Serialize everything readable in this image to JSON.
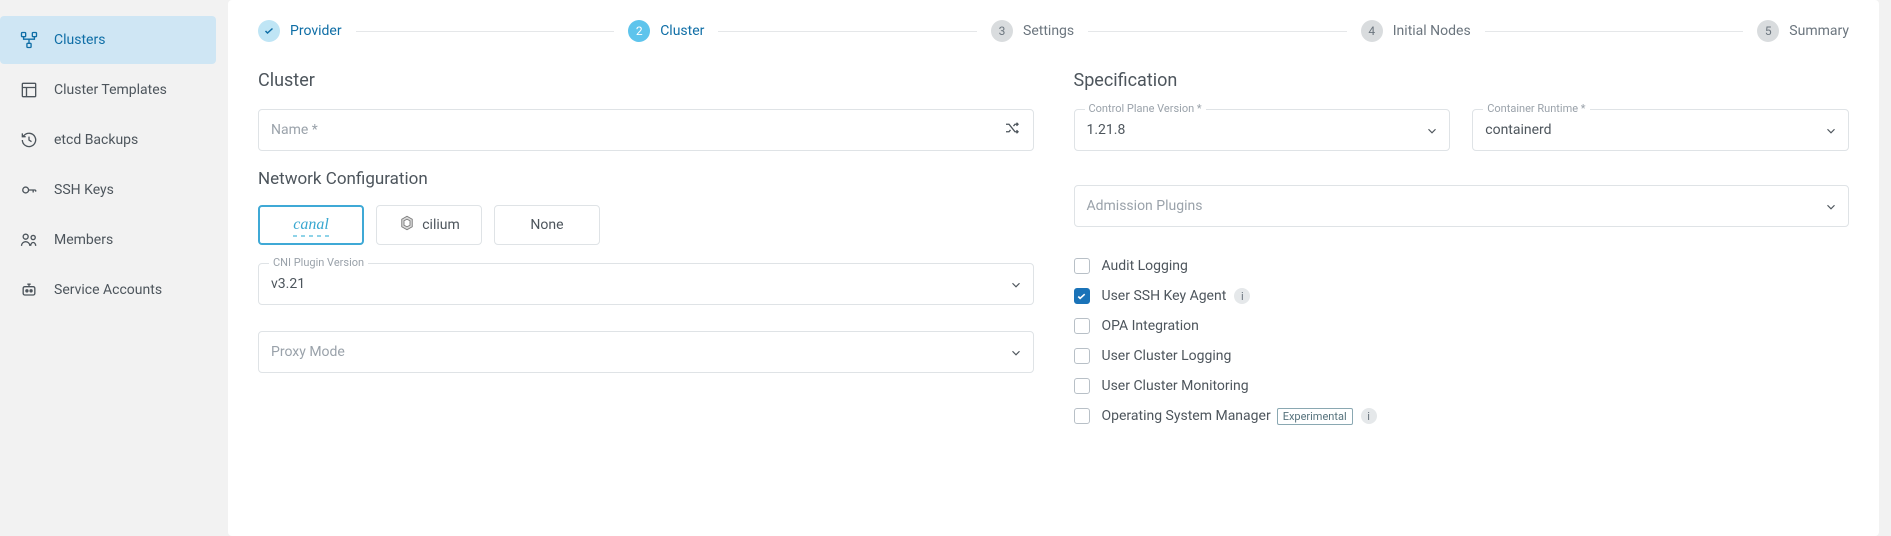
{
  "sidebar": {
    "items": [
      {
        "label": "Clusters",
        "icon": "clusters-icon",
        "active": true
      },
      {
        "label": "Cluster Templates",
        "icon": "template-icon",
        "active": false
      },
      {
        "label": "etcd Backups",
        "icon": "backup-icon",
        "active": false
      },
      {
        "label": "SSH Keys",
        "icon": "key-icon",
        "active": false
      },
      {
        "label": "Members",
        "icon": "members-icon",
        "active": false
      },
      {
        "label": "Service Accounts",
        "icon": "service-accounts-icon",
        "active": false
      }
    ]
  },
  "stepper": {
    "steps": [
      {
        "num": "1",
        "label": "Provider",
        "state": "done"
      },
      {
        "num": "2",
        "label": "Cluster",
        "state": "active"
      },
      {
        "num": "3",
        "label": "Settings",
        "state": "inactive"
      },
      {
        "num": "4",
        "label": "Initial Nodes",
        "state": "inactive"
      },
      {
        "num": "5",
        "label": "Summary",
        "state": "inactive"
      }
    ]
  },
  "cluster": {
    "title": "Cluster",
    "name_label": "Name *",
    "name_value": ""
  },
  "network": {
    "title": "Network Configuration",
    "cni": {
      "options": [
        "canal",
        "cilium",
        "None"
      ],
      "selected": "canal"
    },
    "cni_version_label": "CNI Plugin Version",
    "cni_version_value": "v3.21",
    "proxy_mode_placeholder": "Proxy Mode",
    "proxy_mode_value": ""
  },
  "spec": {
    "title": "Specification",
    "control_plane_label": "Control Plane Version *",
    "control_plane_value": "1.21.8",
    "runtime_label": "Container Runtime *",
    "runtime_value": "containerd",
    "admission_placeholder": "Admission Plugins",
    "checkboxes": [
      {
        "label": "Audit Logging",
        "checked": false,
        "info": false,
        "badge": null
      },
      {
        "label": "User SSH Key Agent",
        "checked": true,
        "info": true,
        "badge": null
      },
      {
        "label": "OPA Integration",
        "checked": false,
        "info": false,
        "badge": null
      },
      {
        "label": "User Cluster Logging",
        "checked": false,
        "info": false,
        "badge": null
      },
      {
        "label": "User Cluster Monitoring",
        "checked": false,
        "info": false,
        "badge": null
      },
      {
        "label": "Operating System Manager",
        "checked": false,
        "info": true,
        "badge": "Experimental"
      }
    ]
  }
}
